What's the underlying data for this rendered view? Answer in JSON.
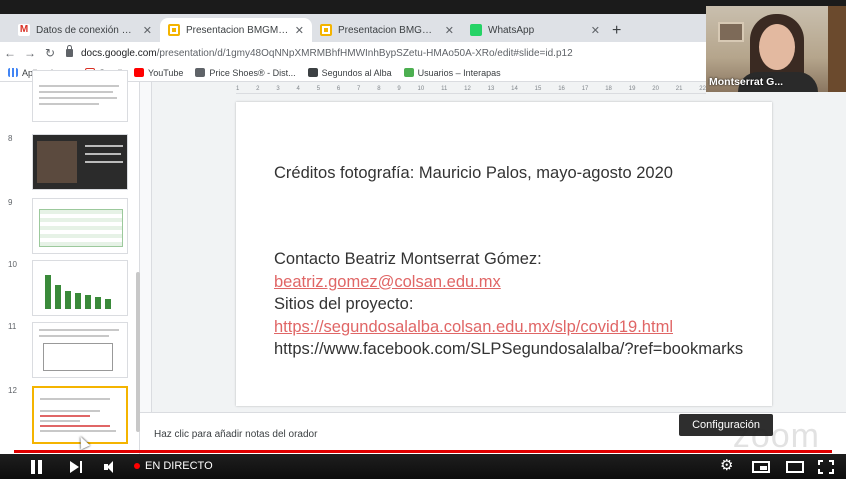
{
  "browser": {
    "tabs": [
      {
        "title": "Datos de conexión para panel e",
        "favicon": "gmail-icon",
        "active": false
      },
      {
        "title": "Presentacion BMGM encuentro y",
        "favicon": "slides-icon",
        "active": true
      },
      {
        "title": "Presentacion BMGM encuentro y",
        "favicon": "slides-icon",
        "active": false
      },
      {
        "title": "WhatsApp",
        "favicon": "whatsapp-icon",
        "active": false
      }
    ],
    "url_host": "docs.google.com",
    "url_path": "/presentation/d/1gmy48OqNNpXMRMBhfHMWInhBypSZetu-HMAo50A-XRo/edit#slide=id.p12",
    "bookmarks": [
      {
        "label": "Aplicaciones",
        "icon": "apps-icon"
      },
      {
        "label": "Gmail",
        "icon": "gmail-icon"
      },
      {
        "label": "YouTube",
        "icon": "youtube-icon"
      },
      {
        "label": "Price Shoes® - Dist...",
        "icon": "price-shoes-icon"
      },
      {
        "label": "Segundos al Alba",
        "icon": "segundos-icon"
      },
      {
        "label": "Usuarios – Interapas",
        "icon": "interapas-icon"
      }
    ]
  },
  "filmstrip": {
    "slide_numbers": [
      "8",
      "9",
      "10",
      "11",
      "12"
    ],
    "selected": "12"
  },
  "slide": {
    "credits": "Créditos fotografía: Mauricio Palos, mayo-agosto 2020",
    "contact_heading": "Contacto Beatriz Montserrat Gómez:",
    "email": "beatriz.gomez@colsan.edu.mx",
    "sites_heading": "Sitios del proyecto:",
    "site_link": "https://segundosalalba.colsan.edu.mx/slp/covid19.html",
    "facebook": "https://www.facebook.com/SLPSegundosalalba/?ref=bookmarks",
    "link_color": "#e06666"
  },
  "notes_placeholder": "Haz clic para añadir notas del orador",
  "watermark": "zoom",
  "webcam": {
    "name": "Montserrat G..."
  },
  "tooltip": "Configuración",
  "player": {
    "live_label": "EN DIRECTO",
    "progress_color": "#e00000",
    "progress_fraction": 1.0
  }
}
